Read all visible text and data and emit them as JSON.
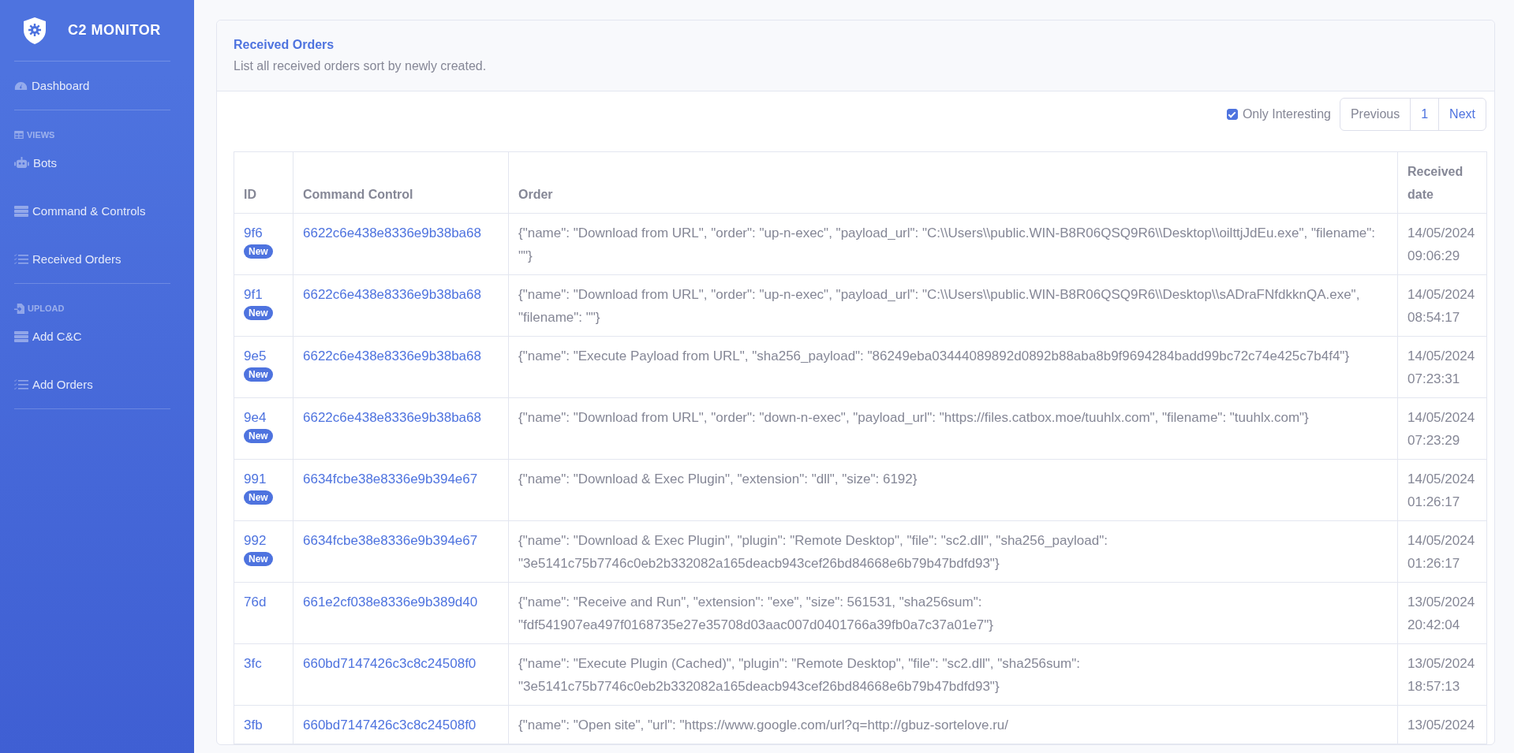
{
  "brand": {
    "title": "C2 MONITOR"
  },
  "sidebar": {
    "items": [
      {
        "kind": "link",
        "label": "Dashboard"
      },
      {
        "kind": "divider"
      },
      {
        "kind": "heading",
        "label": "VIEWS"
      },
      {
        "kind": "link",
        "label": "Bots"
      },
      {
        "kind": "link",
        "label": "Command & Controls"
      },
      {
        "kind": "link",
        "label": "Received Orders"
      },
      {
        "kind": "divider"
      },
      {
        "kind": "heading",
        "label": "UPLOAD"
      },
      {
        "kind": "link",
        "label": "Add C&C"
      },
      {
        "kind": "link",
        "label": "Add Orders"
      },
      {
        "kind": "divider"
      }
    ]
  },
  "card": {
    "title": "Received Orders",
    "subtitle": "List all received orders sort by newly created."
  },
  "filter": {
    "label": "Only Interesting",
    "checked": true
  },
  "pagination": {
    "previous": "Previous",
    "pages": [
      {
        "label": "1",
        "selected": false
      }
    ],
    "next": "Next"
  },
  "table": {
    "columns": [
      "ID",
      "Command Control",
      "Order",
      "Received date"
    ],
    "rows": [
      {
        "id": "9f6",
        "badge": "New",
        "command_control": "6622c6e438e8336e9b38ba68",
        "order": "{\"name\": \"Download from URL\", \"order\": \"up-n-exec\", \"payload_url\": \"C:\\\\Users\\\\public.WIN-B8R06QSQ9R6\\\\Desktop\\\\oilttjJdEu.exe\", \"filename\": \"\"}",
        "date": "14/05/2024 09:06:29"
      },
      {
        "id": "9f1",
        "badge": "New",
        "command_control": "6622c6e438e8336e9b38ba68",
        "order": "{\"name\": \"Download from URL\", \"order\": \"up-n-exec\", \"payload_url\": \"C:\\\\Users\\\\public.WIN-B8R06QSQ9R6\\\\Desktop\\\\sADraFNfdkknQA.exe\", \"filename\": \"\"}",
        "date": "14/05/2024 08:54:17"
      },
      {
        "id": "9e5",
        "badge": "New",
        "command_control": "6622c6e438e8336e9b38ba68",
        "order": "{\"name\": \"Execute Payload from URL\", \"sha256_payload\": \"86249eba03444089892d0892b88aba8b9f9694284badd99bc72c74e425c7b4f4\"}",
        "date": "14/05/2024 07:23:31"
      },
      {
        "id": "9e4",
        "badge": "New",
        "command_control": "6622c6e438e8336e9b38ba68",
        "order": "{\"name\": \"Download from URL\", \"order\": \"down-n-exec\", \"payload_url\": \"https://files.catbox.moe/tuuhlx.com\", \"filename\": \"tuuhlx.com\"}",
        "date": "14/05/2024 07:23:29"
      },
      {
        "id": "991",
        "badge": "New",
        "command_control": "6634fcbe38e8336e9b394e67",
        "order": "{\"name\": \"Download & Exec Plugin\", \"extension\": \"dll\", \"size\": 6192}",
        "date": "14/05/2024 01:26:17"
      },
      {
        "id": "992",
        "badge": "New",
        "command_control": "6634fcbe38e8336e9b394e67",
        "order": "{\"name\": \"Download & Exec Plugin\", \"plugin\": \"Remote Desktop\", \"file\": \"sc2.dll\", \"sha256_payload\": \"3e5141c75b7746c0eb2b332082a165deacb943cef26bd84668e6b79b47bdfd93\"}",
        "date": "14/05/2024 01:26:17"
      },
      {
        "id": "76d",
        "command_control": "661e2cf038e8336e9b389d40",
        "order": "{\"name\": \"Receive and Run\", \"extension\": \"exe\", \"size\": 561531, \"sha256sum\": \"fdf541907ea497f0168735e27e35708d03aac007d0401766a39fb0a7c37a01e7\"}",
        "date": "13/05/2024 20:42:04"
      },
      {
        "id": "3fc",
        "command_control": "660bd7147426c3c8c24508f0",
        "order": "{\"name\": \"Execute Plugin (Cached)\", \"plugin\": \"Remote Desktop\", \"file\": \"sc2.dll\", \"sha256sum\": \"3e5141c75b7746c0eb2b332082a165deacb943cef26bd84668e6b79b47bdfd93\"}",
        "date": "13/05/2024 18:57:13"
      },
      {
        "id": "3fb",
        "command_control": "660bd7147426c3c8c24508f0",
        "order": "{\"name\": \"Open site\", \"url\": \"https://www.google.com/url?q=http://gbuz-sortelove.ru/",
        "date": "13/05/2024"
      }
    ]
  }
}
